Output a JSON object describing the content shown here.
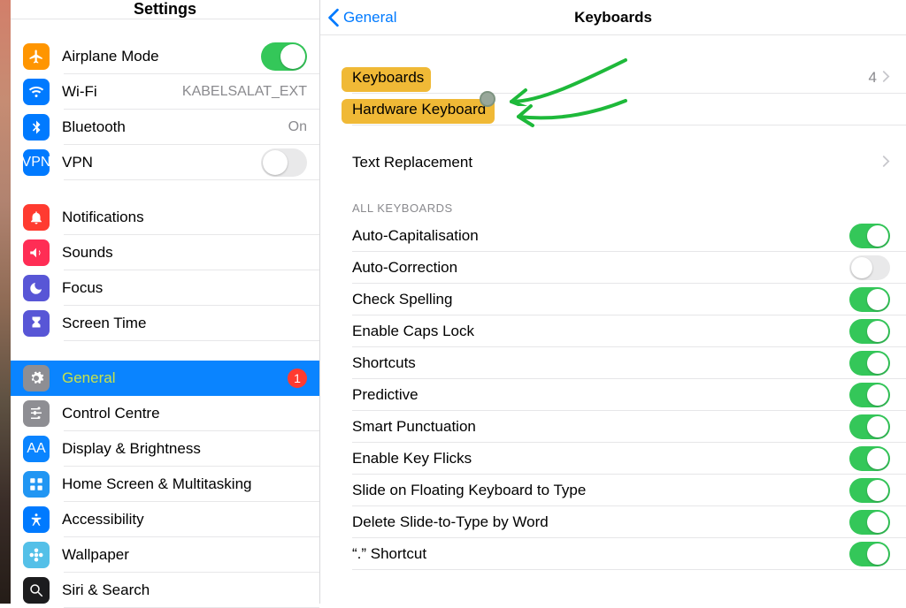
{
  "sidebar": {
    "title": "Settings",
    "groups": [
      [
        {
          "icon": "airplane",
          "label": "Airplane Mode",
          "toggle": true,
          "fill": "#ff9500"
        },
        {
          "icon": "wifi",
          "label": "Wi-Fi",
          "detail": "KABELSALAT_EXT",
          "fill": "#007aff"
        },
        {
          "icon": "bluetooth",
          "label": "Bluetooth",
          "detail": "On",
          "fill": "#007aff"
        },
        {
          "icon": "vpn",
          "label": "VPN",
          "toggle": false,
          "fill": "#007aff"
        }
      ],
      [
        {
          "icon": "bell",
          "label": "Notifications",
          "fill": "#ff3b30"
        },
        {
          "icon": "speaker",
          "label": "Sounds",
          "fill": "#ff2d55"
        },
        {
          "icon": "moon",
          "label": "Focus",
          "fill": "#5856d6"
        },
        {
          "icon": "hourglass",
          "label": "Screen Time",
          "fill": "#5856d6"
        }
      ],
      [
        {
          "icon": "gear",
          "label": "General",
          "selected": true,
          "highlighted": true,
          "badge": "1",
          "fill": "#8e8e93"
        },
        {
          "icon": "sliders",
          "label": "Control Centre",
          "fill": "#8e8e93"
        },
        {
          "icon": "aa",
          "label": "Display & Brightness",
          "fill": "#0a84ff"
        },
        {
          "icon": "grid",
          "label": "Home Screen & Multitasking",
          "fill": "#2196f3"
        },
        {
          "icon": "access",
          "label": "Accessibility",
          "fill": "#007aff"
        },
        {
          "icon": "flower",
          "label": "Wallpaper",
          "fill": "#54c0e8"
        },
        {
          "icon": "search",
          "label": "Siri & Search",
          "fill": "#1c1c1e",
          "truncated": true
        }
      ]
    ]
  },
  "detail": {
    "back": "General",
    "title": "Keyboards",
    "nav_rows": [
      {
        "label": "Keyboards",
        "value": "4",
        "highlighted": true,
        "annotation_arrow": 1
      },
      {
        "label": "Hardware Keyboard",
        "highlighted": true,
        "annotation_arrow": 2
      }
    ],
    "text_replacement": {
      "label": "Text Replacement"
    },
    "section_title": "ALL KEYBOARDS",
    "toggles": [
      {
        "label": "Auto-Capitalisation",
        "on": true
      },
      {
        "label": "Auto-Correction",
        "on": false
      },
      {
        "label": "Check Spelling",
        "on": true
      },
      {
        "label": "Enable Caps Lock",
        "on": true
      },
      {
        "label": "Shortcuts",
        "on": true
      },
      {
        "label": "Predictive",
        "on": true
      },
      {
        "label": "Smart Punctuation",
        "on": true
      },
      {
        "label": "Enable Key Flicks",
        "on": true
      },
      {
        "label": "Slide on Floating Keyboard to Type",
        "on": true
      },
      {
        "label": "Delete Slide-to-Type by Word",
        "on": true
      },
      {
        "label": "“.” Shortcut",
        "on": true
      }
    ]
  }
}
